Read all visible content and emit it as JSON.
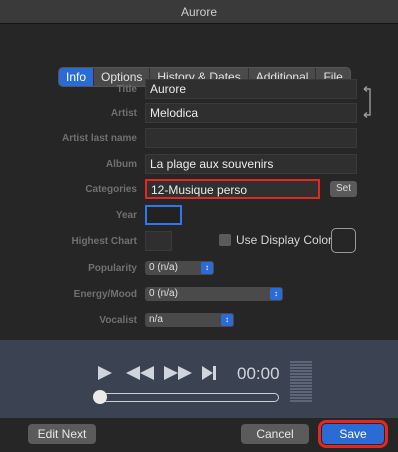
{
  "window": {
    "title": "Aurore"
  },
  "tabs": [
    {
      "label": "Info",
      "active": true
    },
    {
      "label": "Options",
      "active": false
    },
    {
      "label": "History & Dates",
      "active": false
    },
    {
      "label": "Additional",
      "active": false
    },
    {
      "label": "File",
      "active": false
    }
  ],
  "form": {
    "title_label": "Title",
    "title_value": "Aurore",
    "artist_label": "Artist",
    "artist_value": "Melodica",
    "artist_last_label": "Artist last name",
    "artist_last_value": "",
    "album_label": "Album",
    "album_value": "La plage aux souvenirs",
    "categories_label": "Categories",
    "categories_value": "12-Musique perso",
    "set_label": "Set",
    "year_label": "Year",
    "year_value": "",
    "highest_chart_label": "Highest Chart",
    "highest_chart_value": "",
    "use_display_color_label": "Use Display Color",
    "popularity_label": "Popularity",
    "popularity_value": "0 (n/a)",
    "energy_label": "Energy/Mood",
    "energy_value": "0 (n/a)",
    "vocalist_label": "Vocalist",
    "vocalist_value": "n/a"
  },
  "player": {
    "time": "00:00",
    "play_icon": "play-icon",
    "rewind_icon": "rewind-icon",
    "fast_forward_icon": "fast-forward-icon",
    "next_icon": "skip-next-icon",
    "position": 0
  },
  "footer": {
    "edit_next_label": "Edit Next",
    "cancel_label": "Cancel",
    "save_label": "Save"
  },
  "colors": {
    "accent": "#2a6bd6",
    "highlight": "#e8261f",
    "player_bg": "#3b4252"
  }
}
